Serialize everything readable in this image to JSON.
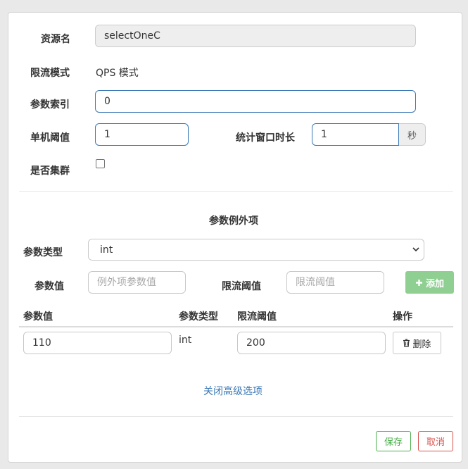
{
  "form": {
    "resource_name": {
      "label": "资源名",
      "value": "selectOneC"
    },
    "flow_mode": {
      "label": "限流模式",
      "value": "QPS 模式"
    },
    "param_index": {
      "label": "参数索引",
      "value": "0"
    },
    "single_threshold": {
      "label": "单机阈值",
      "value": "1"
    },
    "window": {
      "label": "统计窗口时长",
      "value": "1",
      "unit": "秒"
    },
    "cluster": {
      "label": "是否集群",
      "checked": false
    }
  },
  "exceptions": {
    "section_title": "参数例外项",
    "param_type": {
      "label": "参数类型",
      "selected": "int"
    },
    "param_value": {
      "label": "参数值",
      "placeholder": "例外项参数值"
    },
    "threshold": {
      "label": "限流阈值",
      "placeholder": "限流阈值"
    },
    "add_label": "添加",
    "table": {
      "headers": [
        "参数值",
        "参数类型",
        "限流阈值",
        "操作"
      ],
      "rows": [
        {
          "value": "110",
          "type": "int",
          "threshold": "200",
          "action": "删除"
        }
      ]
    }
  },
  "advanced_toggle": "关闭高级选项",
  "footer": {
    "save_label": "保存",
    "cancel_label": "取消"
  },
  "colors": {
    "primary": "#3a78b5",
    "success": "#4cae4c",
    "danger": "#d9534f",
    "add_button": "#8fcf92"
  }
}
